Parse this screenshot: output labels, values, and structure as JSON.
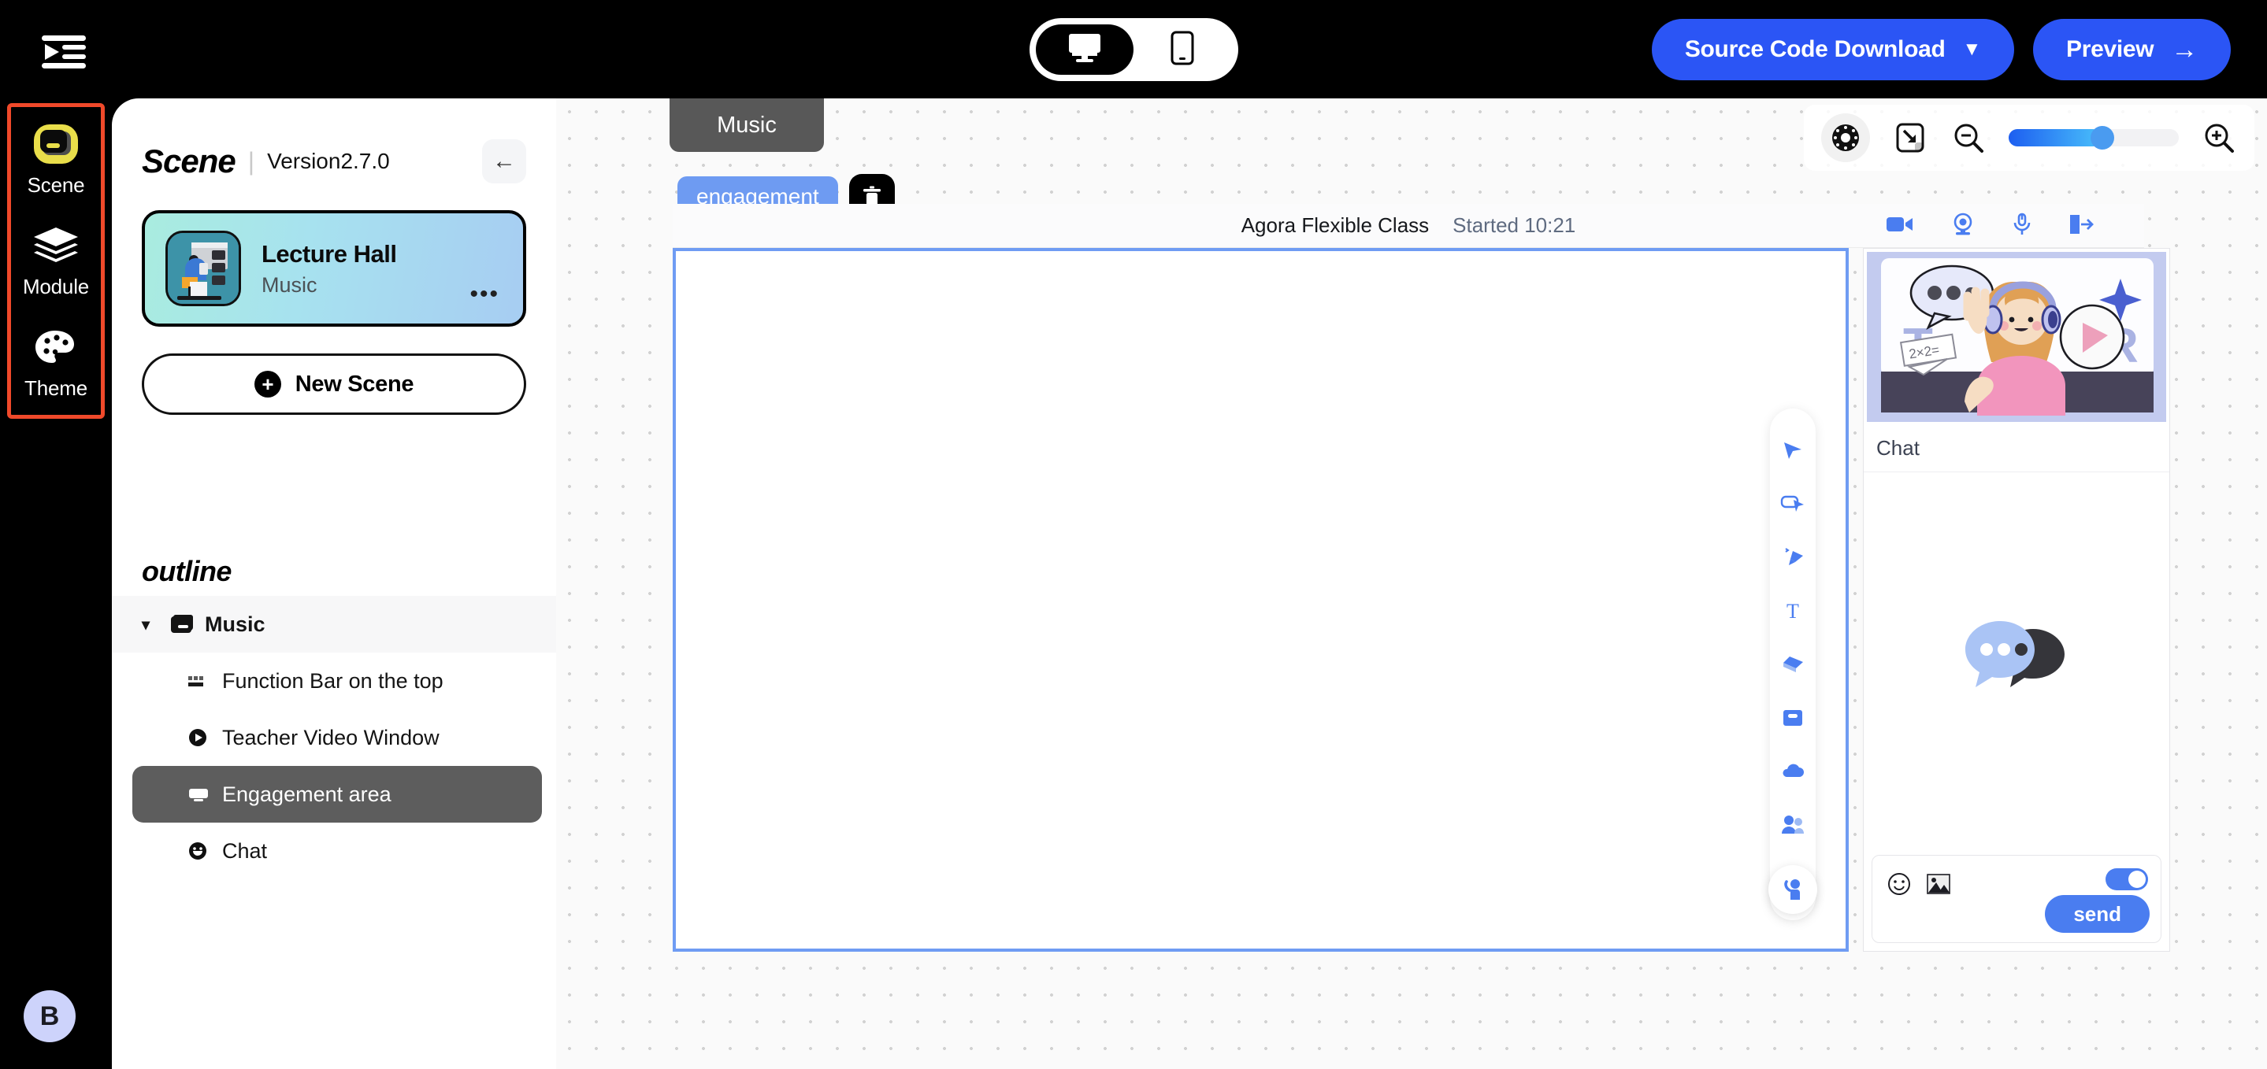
{
  "header": {
    "collapse_icon": "collapse-sidebar-icon",
    "device_toggle": {
      "options": [
        {
          "id": "desktop",
          "icon": "desktop-monitor-icon",
          "active": true
        },
        {
          "id": "mobile",
          "icon": "mobile-phone-icon",
          "active": false
        }
      ]
    },
    "source_code_download_label": "Source Code Download",
    "source_code_caret": "▼",
    "preview_label": "Preview",
    "preview_arrow": "→"
  },
  "rail": {
    "items": [
      {
        "label": "Scene",
        "icon": "scene-icon",
        "active": true
      },
      {
        "label": "Module",
        "icon": "module-layers-icon",
        "active": false
      },
      {
        "label": "Theme",
        "icon": "theme-palette-icon",
        "active": false
      }
    ],
    "avatar_initial": "B",
    "highlight_color": "#f0492a"
  },
  "scene_panel": {
    "title": "Scene",
    "divider": "|",
    "version": "Version2.7.0",
    "back_icon": "←",
    "card": {
      "name": "Lecture Hall",
      "subtitle": "Music",
      "more_icon": "•••",
      "thumb_icon": "lecture-hall-thumbnail"
    },
    "new_scene_label": "New Scene",
    "new_scene_plus": "+",
    "outline_title": "outline",
    "tree": [
      {
        "label": "Music",
        "icon": "window-icon",
        "type": "group",
        "expanded": true,
        "caret": "▾"
      },
      {
        "label": "Function Bar on the top",
        "icon": "function-bar-icon",
        "type": "child",
        "selected": false
      },
      {
        "label": "Teacher Video Window",
        "icon": "video-play-icon",
        "type": "child",
        "selected": false
      },
      {
        "label": "Engagement area",
        "icon": "engagement-area-icon",
        "type": "child",
        "selected": true
      },
      {
        "label": "Chat",
        "icon": "chat-smile-icon",
        "type": "child",
        "selected": false
      }
    ]
  },
  "canvas": {
    "tab_label": "Music",
    "zoom_controls": [
      {
        "name": "loading-ring-icon"
      },
      {
        "name": "fit-to-screen-icon"
      },
      {
        "name": "zoom-out-icon"
      },
      {
        "name": "zoom-slider"
      },
      {
        "name": "zoom-in-icon"
      }
    ],
    "zoom_slider_percent": 48,
    "stage": {
      "tag_label": "engagement",
      "delete_icon": "trash-icon",
      "class_title": "Agora Flexible Class",
      "started_label": "Started 10:21",
      "status_icons": [
        {
          "name": "camera-video-icon"
        },
        {
          "name": "webcam-icon"
        },
        {
          "name": "microphone-icon"
        },
        {
          "name": "exit-door-icon"
        }
      ],
      "tools": [
        {
          "name": "cursor-arrow-icon"
        },
        {
          "name": "select-area-icon"
        },
        {
          "name": "highlighter-pen-icon"
        },
        {
          "name": "text-tool-icon"
        },
        {
          "name": "eraser-icon"
        },
        {
          "name": "save-disk-icon"
        },
        {
          "name": "cloud-icon"
        },
        {
          "name": "roster-people-icon"
        },
        {
          "name": "toolbox-icon"
        }
      ],
      "raise_hand_icon": "raise-hand-icon"
    },
    "chat": {
      "hero_icon": "teacher-illustration",
      "hero_math_text": "2×2=",
      "panel_label": "Chat",
      "empty_icon": "chat-bubbles-icon",
      "emoji_icon": "emoji-smile-icon",
      "image_icon": "image-upload-icon",
      "toggle_on": true,
      "send_label": "send"
    }
  },
  "colors": {
    "brand_blue": "#2b55f5",
    "accent_blue": "#4a7df0",
    "rail_highlight": "#f0492a",
    "selected_gray": "#5d5d5d"
  }
}
